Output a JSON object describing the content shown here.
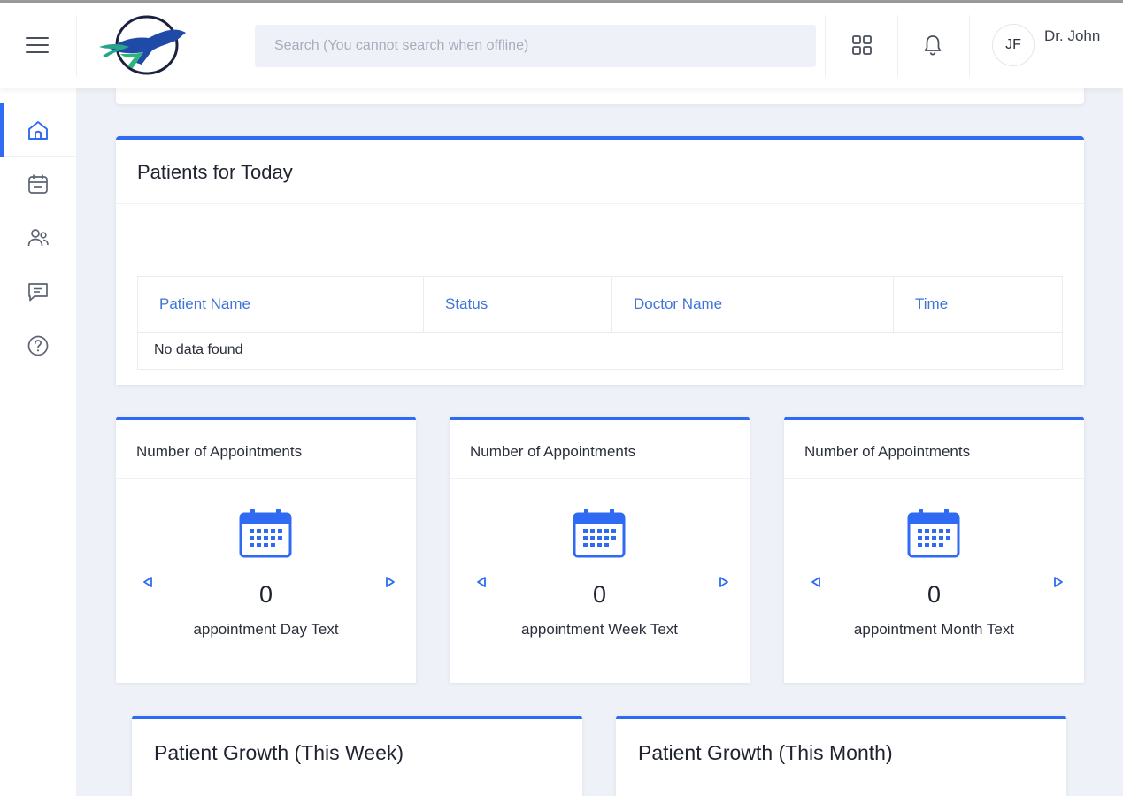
{
  "header": {
    "search_placeholder": "Search (You cannot search when offline)",
    "user_initials": "JF",
    "user_name": "Dr. John"
  },
  "sidebar": {
    "items": [
      {
        "icon": "home-icon",
        "active": true
      },
      {
        "icon": "calendar-icon",
        "active": false
      },
      {
        "icon": "users-icon",
        "active": false
      },
      {
        "icon": "chat-icon",
        "active": false
      },
      {
        "icon": "help-icon",
        "active": false
      }
    ]
  },
  "patients_today": {
    "title": "Patients for Today",
    "columns": [
      "Patient Name",
      "Status",
      "Doctor Name",
      "Time"
    ],
    "empty_text": "No data found"
  },
  "appointments": [
    {
      "title": "Number of Appointments",
      "count": "0",
      "label": "appointment Day Text"
    },
    {
      "title": "Number of Appointments",
      "count": "0",
      "label": "appointment Week Text"
    },
    {
      "title": "Number of Appointments",
      "count": "0",
      "label": "appointment Month Text"
    }
  ],
  "growth": {
    "week_title": "Patient Growth (This Week)",
    "month_title": "Patient Growth (This Month)"
  },
  "colors": {
    "accent": "#2f6bf2",
    "header_link": "#3f74d6",
    "background": "#eef1f7"
  }
}
